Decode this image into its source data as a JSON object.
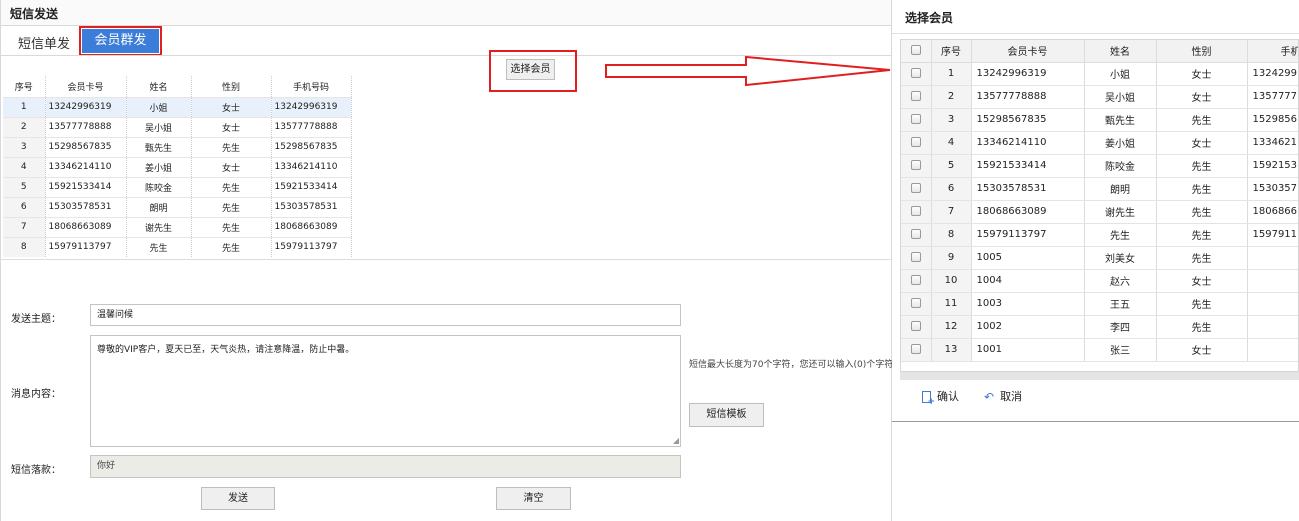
{
  "left": {
    "title": "短信发送",
    "tabs": {
      "single": "短信单发",
      "group": "会员群发"
    },
    "select_member_button": "选择会员",
    "table": {
      "headers": [
        "序号",
        "会员卡号",
        "姓名",
        "性别",
        "手机号码"
      ],
      "rows": [
        [
          "1",
          "13242996319",
          "小姐",
          "女士",
          "13242996319"
        ],
        [
          "2",
          "13577778888",
          "吴小姐",
          "女士",
          "13577778888"
        ],
        [
          "3",
          "15298567835",
          "甄先生",
          "先生",
          "15298567835"
        ],
        [
          "4",
          "13346214110",
          "姜小姐",
          "女士",
          "13346214110"
        ],
        [
          "5",
          "15921533414",
          "陈咬金",
          "先生",
          "15921533414"
        ],
        [
          "6",
          "15303578531",
          "朗明",
          "先生",
          "15303578531"
        ],
        [
          "7",
          "18068663089",
          "谢先生",
          "先生",
          "18068663089"
        ],
        [
          "8",
          "15979113797",
          "先生",
          "先生",
          "15979113797"
        ]
      ]
    },
    "form": {
      "subject_label": "发送主题：",
      "subject_value": "温馨问候",
      "content_label": "消息内容：",
      "content_value": "尊敬的VIP客户，夏天已至，天气炎热，请注意降温，防止中暑。",
      "sign_label": "短信落款：",
      "sign_value": "你好",
      "hint": "短信最大长度为70个字符，您还可以输入(0)个字符",
      "template_button": "短信模板",
      "send_button": "发送",
      "clear_button": "清空"
    }
  },
  "dialog": {
    "title": "选择会员",
    "headers": [
      "序号",
      "会员卡号",
      "姓名",
      "性别",
      "手机"
    ],
    "rows": [
      [
        "1",
        "13242996319",
        "小姐",
        "女士",
        "1324299"
      ],
      [
        "2",
        "13577778888",
        "吴小姐",
        "女士",
        "1357777"
      ],
      [
        "3",
        "15298567835",
        "甄先生",
        "先生",
        "1529856"
      ],
      [
        "4",
        "13346214110",
        "姜小姐",
        "女士",
        "1334621"
      ],
      [
        "5",
        "15921533414",
        "陈咬金",
        "先生",
        "1592153"
      ],
      [
        "6",
        "15303578531",
        "朗明",
        "先生",
        "1530357"
      ],
      [
        "7",
        "18068663089",
        "谢先生",
        "先生",
        "1806866"
      ],
      [
        "8",
        "15979113797",
        "先生",
        "先生",
        "1597911"
      ],
      [
        "9",
        "1005",
        "刘美女",
        "先生",
        ""
      ],
      [
        "10",
        "1004",
        "赵六",
        "女士",
        ""
      ],
      [
        "11",
        "1003",
        "王五",
        "先生",
        ""
      ],
      [
        "12",
        "1002",
        "李四",
        "先生",
        ""
      ],
      [
        "13",
        "1001",
        "张三",
        "女士",
        ""
      ]
    ],
    "confirm_label": "确认",
    "cancel_label": "取消"
  },
  "icons": {
    "arrow": "right-arrow-icon",
    "confirm": "document-add-icon",
    "cancel": "undo-icon"
  },
  "colors": {
    "accent": "#3b7dd8",
    "highlight": "#e02020",
    "selected_row": "#e8f0fb"
  }
}
